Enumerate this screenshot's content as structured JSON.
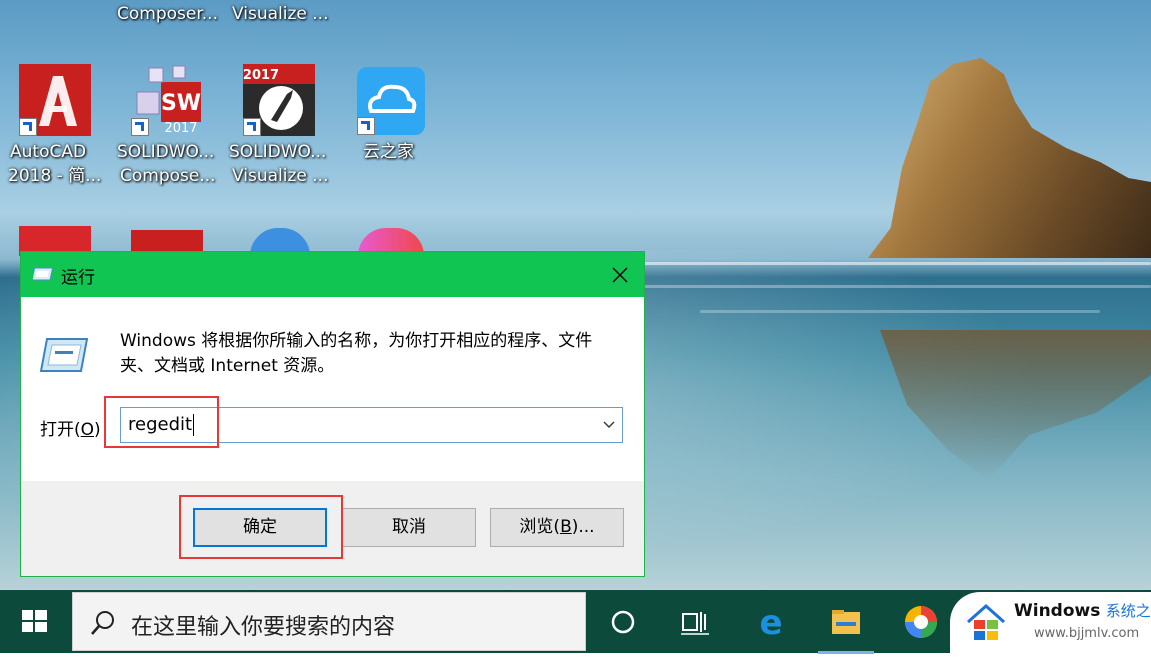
{
  "desktop": {
    "icons_row0": [
      {
        "label": "Composer..."
      },
      {
        "label": "Visualize ..."
      }
    ],
    "icons_row1": [
      {
        "label1": "AutoCAD",
        "label2": "2018 - 简...",
        "icon": "autocad-icon"
      },
      {
        "label1": "SOLIDWO...",
        "label2": "Compose...",
        "icon": "solidworks-composer-icon"
      },
      {
        "label1": "SOLIDWO...",
        "label2": "Visualize ...",
        "icon": "solidworks-visualize-icon"
      },
      {
        "label1": "云之家",
        "label2": "",
        "icon": "yunzhijia-icon"
      }
    ]
  },
  "dialog": {
    "title": "运行",
    "description": "Windows 将根据你所输入的名称，为你打开相应的程序、文件夹、文档或 Internet 资源。",
    "open_label_prefix": "打开(",
    "open_label_key": "O",
    "open_label_suffix": ")",
    "input_value": "regedit",
    "buttons": {
      "ok": "确定",
      "cancel": "取消",
      "browse_prefix": "浏览(",
      "browse_key": "B",
      "browse_suffix": ")..."
    }
  },
  "taskbar": {
    "search_placeholder": "在这里输入你要搜索的内容",
    "apps": [
      "cortana-icon",
      "task-view-icon",
      "edge-icon",
      "file-explorer-icon",
      "colorful-app-icon"
    ]
  },
  "watermark": {
    "brand": "Windows",
    "brand_suffix": "系统之家",
    "url": "www.bjjmlv.com"
  },
  "colors": {
    "titlebar": "#10c552",
    "highlight": "#e53935",
    "taskbar": "#0c4a3c"
  }
}
